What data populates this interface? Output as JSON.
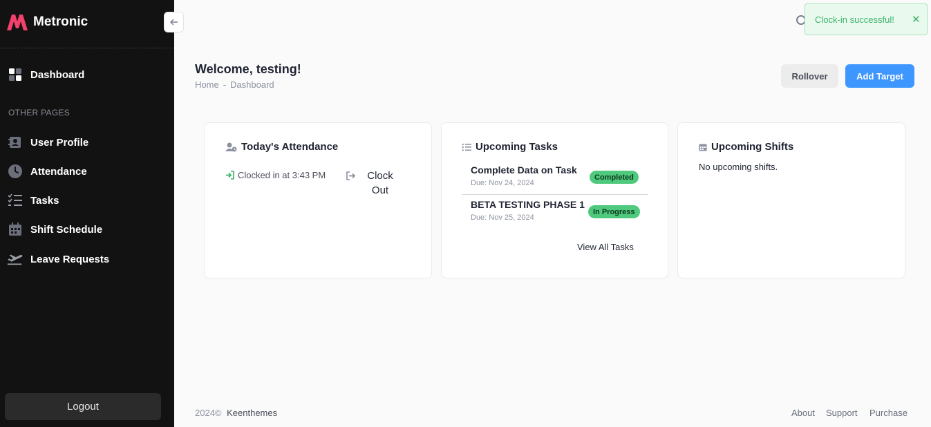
{
  "brand": {
    "name": "Metronic",
    "logo_color": "#f1416c"
  },
  "sidebar": {
    "collapse_icon": "arrow-left-icon",
    "items": [
      {
        "label": "Dashboard",
        "icon": "dashboard-icon"
      },
      {
        "label": "User Profile",
        "icon": "user-card-icon"
      },
      {
        "label": "Attendance",
        "icon": "clock-icon"
      },
      {
        "label": "Tasks",
        "icon": "checklist-icon"
      },
      {
        "label": "Shift Schedule",
        "icon": "calendar-icon"
      },
      {
        "label": "Leave Requests",
        "icon": "plane-takeoff-icon"
      }
    ],
    "section_label": "OTHER PAGES",
    "logout_label": "Logout"
  },
  "toast": {
    "message": "Clock-in successful!",
    "close_glyph": "✕",
    "color": "#3bb36a"
  },
  "header": {
    "title": "Welcome, testing!",
    "breadcrumb": [
      "Home",
      "-",
      "Dashboard"
    ],
    "rollover_label": "Rollover",
    "add_target_label": "Add Target",
    "accent": "#3e97ff"
  },
  "attendance": {
    "title": "Today's Attendance",
    "clocked_in_text": "Clocked in at 3:43 PM",
    "clock_out_label": "Clock Out"
  },
  "tasks": {
    "title": "Upcoming Tasks",
    "items": [
      {
        "title": "Complete Data on Task",
        "due": "Due: Nov 24, 2024",
        "status": "Completed"
      },
      {
        "title": "BETA TESTING PHASE 1",
        "due": "Due: Nov 25, 2024",
        "status": "In Progress"
      }
    ],
    "view_all_label": "View All Tasks",
    "status_color": "#4fc97d"
  },
  "shifts": {
    "title": "Upcoming Shifts",
    "empty_text": "No upcoming shifts."
  },
  "footer": {
    "copyright": "2024©",
    "company": "Keenthemes",
    "links": [
      "About",
      "Support",
      "Purchase"
    ]
  }
}
